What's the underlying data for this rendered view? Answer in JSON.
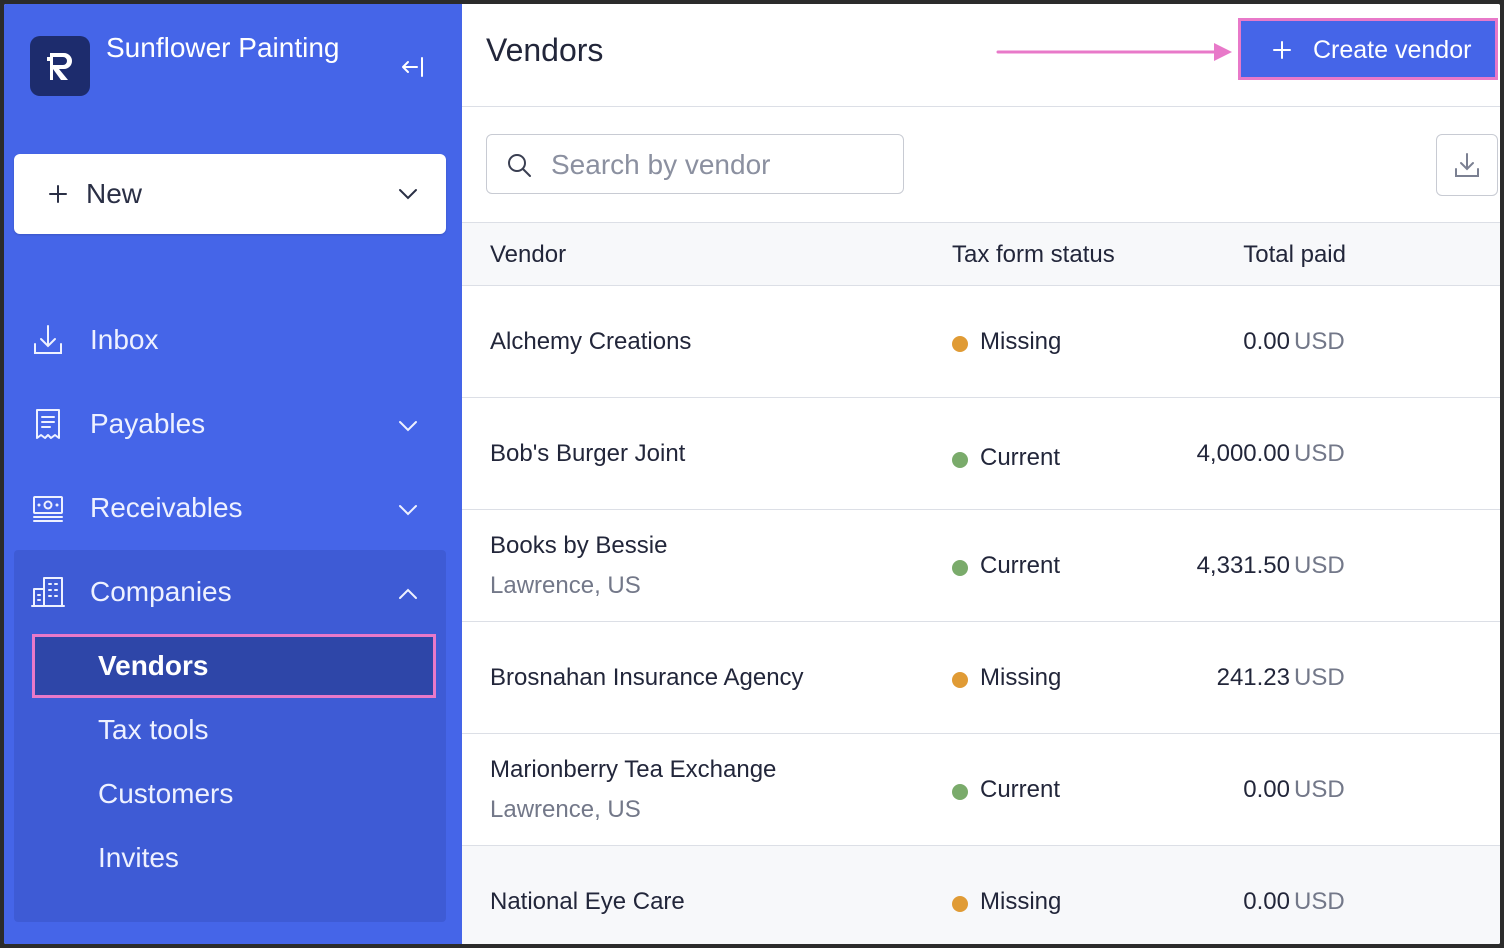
{
  "sidebar": {
    "org_name": "Sunflower Painting",
    "new_label": "New",
    "nav": {
      "inbox": "Inbox",
      "payables": "Payables",
      "receivables": "Receivables",
      "companies": "Companies"
    },
    "companies_sub": {
      "vendors": "Vendors",
      "tax_tools": "Tax tools",
      "customers": "Customers",
      "invites": "Invites"
    }
  },
  "main": {
    "title": "Vendors",
    "create_label": "Create vendor",
    "search_placeholder": "Search by vendor",
    "columns": {
      "vendor": "Vendor",
      "tax_status": "Tax form status",
      "total_paid": "Total paid"
    },
    "rows": [
      {
        "name": "Alchemy Creations",
        "location": "",
        "status": "Missing",
        "amount": "0.00",
        "currency": "USD"
      },
      {
        "name": "Bob's Burger Joint",
        "location": "",
        "status": "Current",
        "amount": "4,000.00",
        "currency": "USD"
      },
      {
        "name": "Books by Bessie",
        "location": "Lawrence, US",
        "status": "Current",
        "amount": "4,331.50",
        "currency": "USD"
      },
      {
        "name": "Brosnahan Insurance Agency",
        "location": "",
        "status": "Missing",
        "amount": "241.23",
        "currency": "USD"
      },
      {
        "name": "Marionberry Tea Exchange",
        "location": "Lawrence, US",
        "status": "Current",
        "amount": "0.00",
        "currency": "USD"
      },
      {
        "name": "National Eye Care",
        "location": "",
        "status": "Missing",
        "amount": "0.00",
        "currency": "USD"
      }
    ]
  },
  "colors": {
    "sidebar": "#4565e8",
    "companies_group": "#3e5bd5",
    "active_item": "#2e46a8",
    "highlight": "#e879c9",
    "status_missing": "#e09b35",
    "status_current": "#7aab6b"
  }
}
